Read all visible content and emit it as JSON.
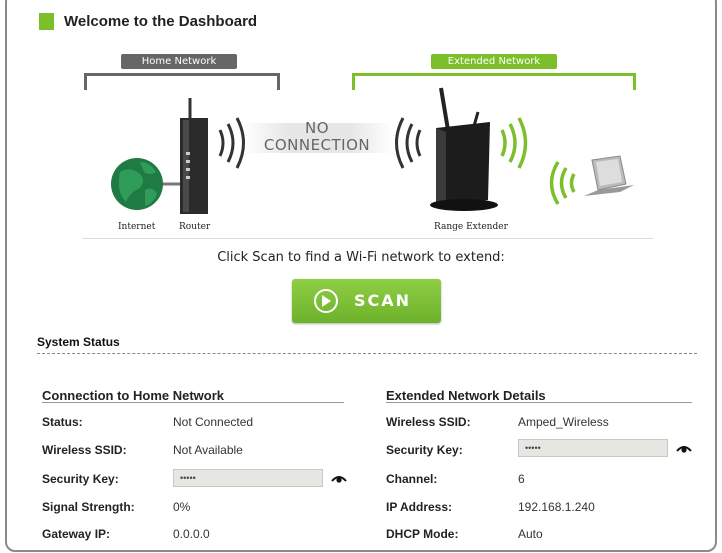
{
  "header": {
    "title": "Welcome to the Dashboard"
  },
  "diagram": {
    "home_network_label": "Home Network",
    "extended_network_label": "Extended Network",
    "internet_label": "Internet",
    "router_label": "Router",
    "range_extender_label": "Range Extender",
    "status_line1": "NO",
    "status_line2": "CONNECTION"
  },
  "instruction": "Click Scan to find a Wi-Fi network to extend:",
  "scan_button": {
    "label": "SCAN"
  },
  "system_status": {
    "title": "System Status",
    "home": {
      "title": "Connection to Home Network",
      "status_label": "Status:",
      "status_value": "Not Connected",
      "ssid_label": "Wireless SSID:",
      "ssid_value": "Not Available",
      "key_label": "Security Key:",
      "key_value": "•••••",
      "signal_label": "Signal Strength:",
      "signal_value": "0%",
      "gateway_label": "Gateway IP:",
      "gateway_value": "0.0.0.0"
    },
    "extended": {
      "title": "Extended Network Details",
      "ssid_label": "Wireless SSID:",
      "ssid_value": "Amped_Wireless",
      "key_label": "Security Key:",
      "key_value": "•••••",
      "channel_label": "Channel:",
      "channel_value": "6",
      "ip_label": "IP Address:",
      "ip_value": "192.168.1.240",
      "dhcp_label": "DHCP Mode:",
      "dhcp_value": "Auto"
    }
  },
  "colors": {
    "accent_green": "#7bbf2a",
    "home_gray": "#666666",
    "frame_gray": "#8a8a8a"
  }
}
